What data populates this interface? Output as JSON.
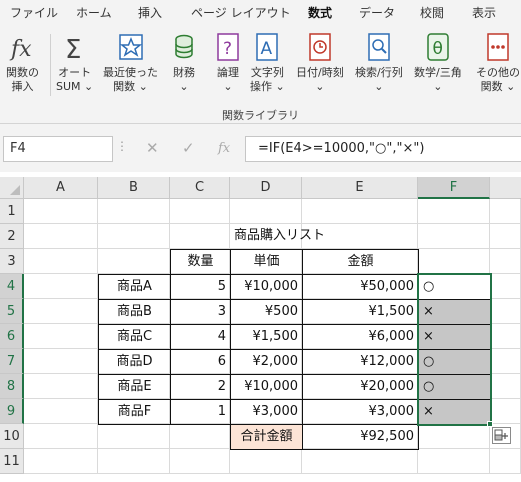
{
  "tabs": [
    "ファイル",
    "ホーム",
    "挿入",
    "ページ レイアウト",
    "数式",
    "データ",
    "校閲",
    "表示"
  ],
  "active_tab": "数式",
  "ribbon": {
    "insert_function": "関数の\n挿入",
    "autosum": "オート\nSUM ⌄",
    "recent": "最近使った\n関数 ⌄",
    "financial": "財務\n⌄",
    "logical": "論理\n⌄",
    "text": "文字列\n操作 ⌄",
    "datetime": "日付/時刻\n⌄",
    "lookup": "検索/行列\n⌄",
    "math": "数学/三角\n⌄",
    "more": "その他の\n関数 ⌄",
    "group_label": "関数ライブラリ"
  },
  "formula_bar": {
    "name_box": "F4",
    "dots": "⋮",
    "cancel": "✕",
    "enter": "✓",
    "fx": "fx",
    "formula": "=IF(E4>=10000,\"○\",\"×\")"
  },
  "columns": [
    "A",
    "B",
    "C",
    "D",
    "E",
    "F"
  ],
  "rows": [
    "1",
    "2",
    "3",
    "4",
    "5",
    "6",
    "7",
    "8",
    "9",
    "10",
    "11"
  ],
  "sheet": {
    "title": "商品購入リスト",
    "headers": [
      "数量",
      "単価",
      "金額"
    ],
    "items": [
      {
        "name": "商品A",
        "qty": "5",
        "price": "¥10,000",
        "amount": "¥50,000",
        "mark": "○"
      },
      {
        "name": "商品B",
        "qty": "3",
        "price": "¥500",
        "amount": "¥1,500",
        "mark": "×"
      },
      {
        "name": "商品C",
        "qty": "4",
        "price": "¥1,500",
        "amount": "¥6,000",
        "mark": "×"
      },
      {
        "name": "商品D",
        "qty": "6",
        "price": "¥2,000",
        "amount": "¥12,000",
        "mark": "○"
      },
      {
        "name": "商品E",
        "qty": "2",
        "price": "¥10,000",
        "amount": "¥20,000",
        "mark": "○"
      },
      {
        "name": "商品F",
        "qty": "1",
        "price": "¥3,000",
        "amount": "¥3,000",
        "mark": "×"
      }
    ],
    "total_label": "合計金額",
    "total_value": "¥92,500"
  },
  "colors": {
    "accent": "#217346",
    "selection": "#c6c6c6",
    "total_label_bg": "#fce4d6"
  }
}
